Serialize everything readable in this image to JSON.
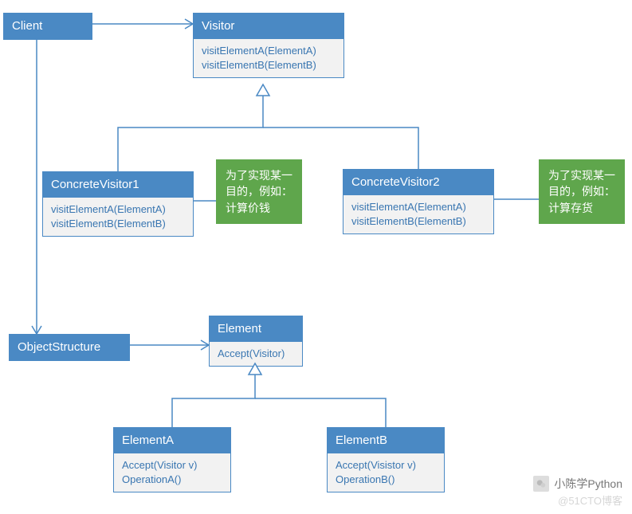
{
  "boxes": {
    "client": {
      "title": "Client"
    },
    "visitor": {
      "title": "Visitor",
      "body": [
        "visitElementA(ElementA)",
        "visitElementB(ElementB)"
      ]
    },
    "cv1": {
      "title": "ConcreteVisitor1",
      "body": [
        "visitElementA(ElementA)",
        "visitElementB(ElementB)"
      ]
    },
    "cv2": {
      "title": "ConcreteVisitor2",
      "body": [
        "visitElementA(ElementA)",
        "visitElementB(ElementB)"
      ]
    },
    "objstruct": {
      "title": "ObjectStructure"
    },
    "element": {
      "title": "Element",
      "body": [
        "Accept(Visitor)"
      ]
    },
    "elemA": {
      "title": "ElementA",
      "body": [
        "Accept(Visitor v)",
        "OperationA()"
      ]
    },
    "elemB": {
      "title": "ElementB",
      "body": [
        "Accept(Visistor v)",
        "OperationB()"
      ]
    }
  },
  "notes": {
    "note1": "为了实现某一目的，例如：计算价钱",
    "note2": "为了实现某一目的，例如：计算存货"
  },
  "watermark": {
    "label": "小陈学Python",
    "sub": "@51CTO博客"
  },
  "colors": {
    "primary": "#4A89C4",
    "note": "#5FA64C",
    "bodytext": "#3976B1"
  }
}
